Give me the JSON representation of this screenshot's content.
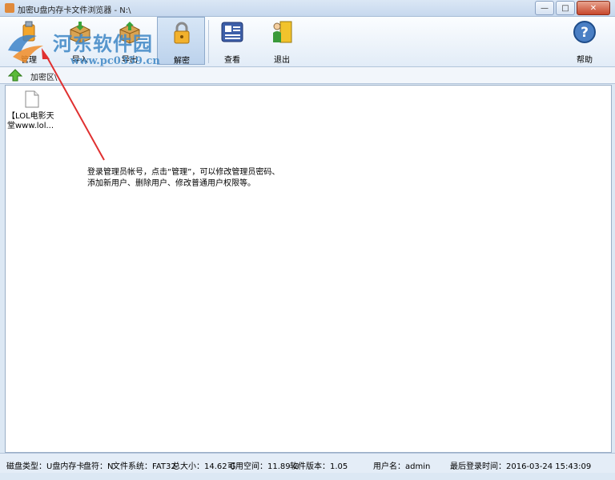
{
  "window": {
    "title": "加密U盘内存卡文件浏览器 - N:\\",
    "minimize": "—",
    "maximize": "□",
    "close": "✕"
  },
  "toolbar": {
    "buttons": [
      {
        "label": "管理",
        "icon": "manage-icon"
      },
      {
        "label": "导入",
        "icon": "import-icon"
      },
      {
        "label": "导出",
        "icon": "export-icon"
      },
      {
        "label": "解密",
        "icon": "lock-icon"
      },
      {
        "label": "查看",
        "icon": "view-icon"
      },
      {
        "label": "退出",
        "icon": "exit-icon"
      }
    ],
    "help_label": "帮助",
    "help_icon": "help-icon"
  },
  "watermark": {
    "name": "河东软件园",
    "url": "www.pc0359.cn"
  },
  "pathbar": {
    "path": "加密区\\"
  },
  "files": [
    {
      "name_line1": "【LOL电影天",
      "name_line2": "堂www.lol..."
    }
  ],
  "annotation": {
    "line1": "登录管理员帐号，点击“管理”，可以修改管理员密码、",
    "line2": "添加新用户、删除用户、修改普通用户权限等。"
  },
  "status": {
    "disk_type": "磁盘类型：U盘内存卡",
    "drive": "盘符：N",
    "fs": "文件系统：FAT32",
    "total": "总大小：14.62 G",
    "free": "可用空间：11.89 G",
    "version": "软件版本：1.05",
    "user": "用户名：admin",
    "last_login": "最后登录时间：2016-03-24 15:43:09"
  },
  "colors": {
    "arrow": "#e03030",
    "accent": "#468cc8"
  }
}
